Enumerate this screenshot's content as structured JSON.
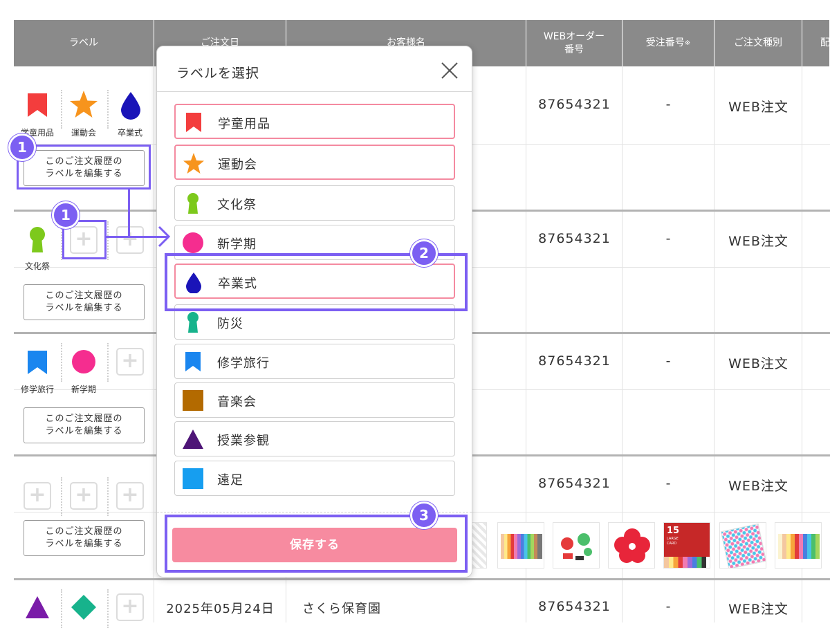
{
  "table": {
    "headers": [
      "ラベル",
      "ご注文日",
      "お客様名",
      "WEBオーダー",
      "番号",
      "受注番号",
      "※",
      "ご注文種別",
      "配"
    ],
    "rows": [
      {
        "web_order": "87654321",
        "order_no": "-",
        "type": "WEB注文",
        "labels": [
          "学童用品",
          "運動会",
          "卒業式"
        ]
      },
      {
        "web_order": "87654321",
        "order_no": "-",
        "type": "WEB注文",
        "labels": [
          "文化祭"
        ]
      },
      {
        "web_order": "87654321",
        "order_no": "-",
        "type": "WEB注文",
        "labels": [
          "修学旅行",
          "新学期"
        ]
      },
      {
        "web_order": "87654321",
        "order_no": "-",
        "type": "WEB注文",
        "labels": []
      },
      {
        "date": "2025年05月24日",
        "customer": "さくら保育園",
        "web_order": "87654321",
        "order_no": "-",
        "type": "WEB注文"
      }
    ],
    "edit_button": [
      "このご注文履歴の",
      "ラベルを編集する"
    ],
    "thumb_text": {
      "t1": "15",
      "t2": "LARGE",
      "t3": "CARD"
    }
  },
  "modal": {
    "title": "ラベルを選択",
    "close_icon": "close-icon",
    "save_label": "保存する",
    "save_color": "#f78ba0",
    "options": [
      {
        "label": "学童用品",
        "icon": "bookmark-icon",
        "color": "#f33d3d",
        "selected": true
      },
      {
        "label": "運動会",
        "icon": "star-icon",
        "color": "#f7941d",
        "selected": true
      },
      {
        "label": "文化祭",
        "icon": "pin-icon",
        "color": "#7dc91c",
        "selected": false
      },
      {
        "label": "新学期",
        "icon": "circle-icon",
        "color": "#f52d8f",
        "selected": false
      },
      {
        "label": "卒業式",
        "icon": "drop-icon",
        "color": "#1a14b8",
        "selected": true
      },
      {
        "label": "防災",
        "icon": "pin-icon",
        "color": "#17b38c",
        "selected": false
      },
      {
        "label": "修学旅行",
        "icon": "bookmark-icon",
        "color": "#1a86ef",
        "selected": false
      },
      {
        "label": "音楽会",
        "icon": "square-icon",
        "color": "#b36a00",
        "selected": false
      },
      {
        "label": "授業参観",
        "icon": "triangle-icon",
        "color": "#4e1577",
        "selected": false
      },
      {
        "label": "遠足",
        "icon": "square-icon",
        "color": "#169ef0",
        "selected": false
      }
    ]
  },
  "annotations": {
    "b1": "1",
    "b2": "2",
    "b3": "3",
    "color": "#7c5ff2"
  }
}
